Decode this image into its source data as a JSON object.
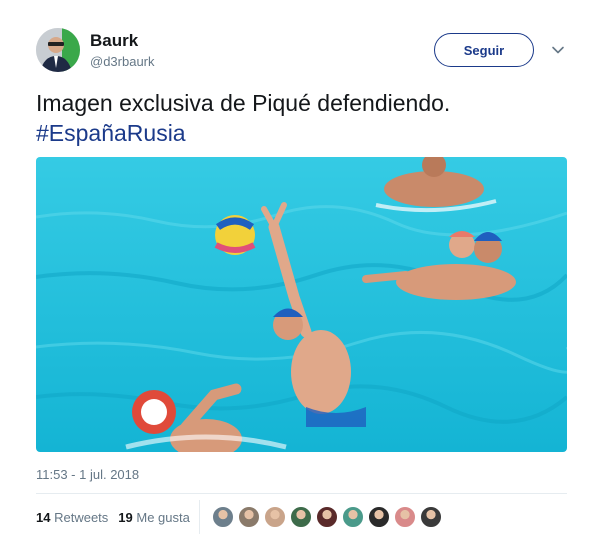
{
  "user": {
    "display_name": "Baurk",
    "handle": "@d3rbaurk",
    "avatar_icon": "user-avatar-icon"
  },
  "actions": {
    "follow_label": "Seguir",
    "menu_icon": "chevron-down-icon"
  },
  "tweet": {
    "text": "Imagen exclusiva de Piqué defendiendo.",
    "hashtag": "#EspañaRusia",
    "media_description_icon": "photo-water-polo"
  },
  "meta": {
    "timestamp": "11:53 - 1 jul. 2018"
  },
  "stats": {
    "retweets_count": "14",
    "retweets_label": "Retweets",
    "likes_count": "19",
    "likes_label": "Me gusta"
  },
  "likers": [
    {
      "name": "liker-avatar-1",
      "color": "#6d7f8c"
    },
    {
      "name": "liker-avatar-2",
      "color": "#8a7a6a"
    },
    {
      "name": "liker-avatar-3",
      "color": "#c9a48a"
    },
    {
      "name": "liker-avatar-4",
      "color": "#3d6b4a"
    },
    {
      "name": "liker-avatar-5",
      "color": "#5a2a2a"
    },
    {
      "name": "liker-avatar-6",
      "color": "#4a9a8a"
    },
    {
      "name": "liker-avatar-7",
      "color": "#2a2a2a"
    },
    {
      "name": "liker-avatar-8",
      "color": "#d98a8a"
    },
    {
      "name": "liker-avatar-9",
      "color": "#3a3a3a"
    }
  ],
  "colors": {
    "accent": "#1b3a8a",
    "secondary_text": "#657786",
    "pool_water": "#1fc2dc"
  }
}
